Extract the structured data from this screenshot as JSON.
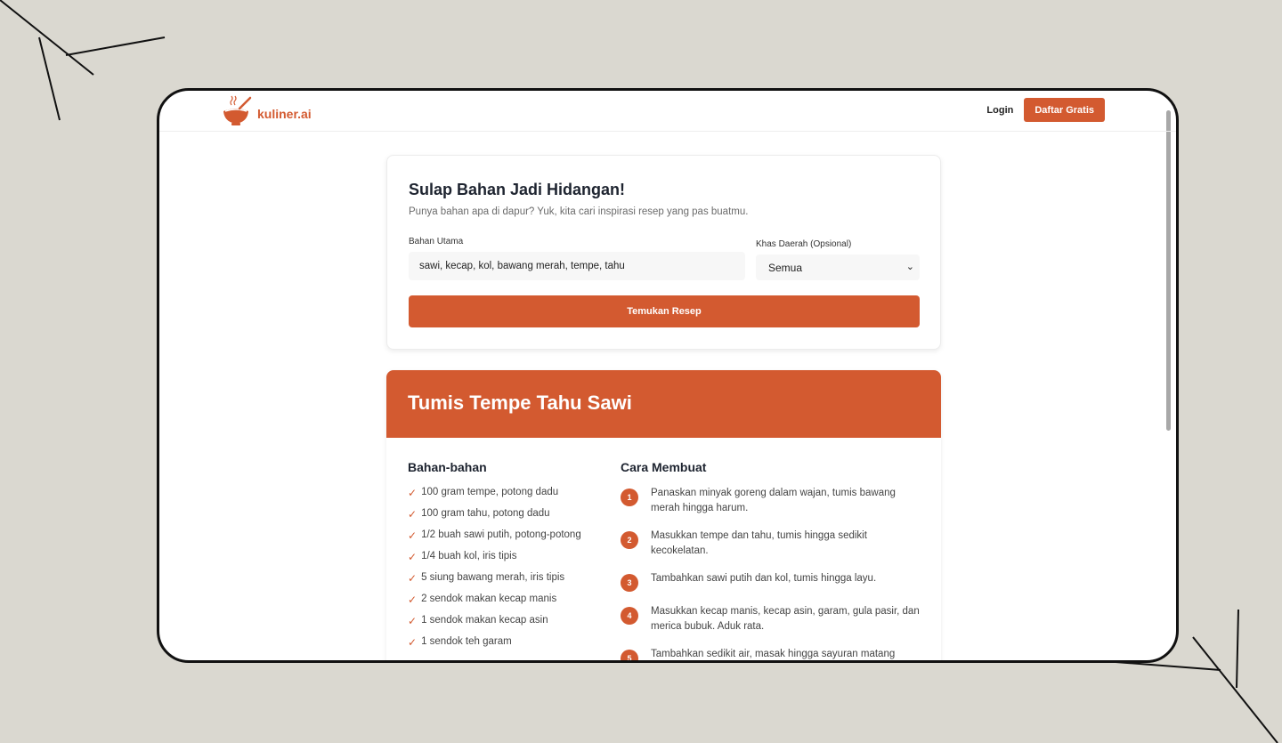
{
  "nav": {
    "brand": "kuliner.ai",
    "login": "Login",
    "signup": "Daftar Gratis"
  },
  "search": {
    "title": "Sulap Bahan Jadi Hidangan!",
    "subtitle": "Punya bahan apa di dapur? Yuk, kita cari inspirasi resep yang pas buatmu.",
    "ingredients_label": "Bahan Utama",
    "ingredients_value": "sawi, kecap, kol, bawang merah, tempe, tahu",
    "region_label": "Khas Daerah (Opsional)",
    "region_value": "Semua",
    "submit": "Temukan Resep"
  },
  "recipe": {
    "title": "Tumis Tempe Tahu Sawi",
    "ingredients_heading": "Bahan-bahan",
    "steps_heading": "Cara Membuat",
    "ingredients": [
      "100 gram tempe, potong dadu",
      "100 gram tahu, potong dadu",
      "1/2 buah sawi putih, potong-potong",
      "1/4 buah kol, iris tipis",
      "5 siung bawang merah, iris tipis",
      "2 sendok makan kecap manis",
      "1 sendok makan kecap asin",
      "1 sendok teh garam"
    ],
    "steps": [
      {
        "n": "1",
        "text": "Panaskan minyak goreng dalam wajan, tumis bawang merah hingga harum."
      },
      {
        "n": "2",
        "text": "Masukkan tempe dan tahu, tumis hingga sedikit kecokelatan."
      },
      {
        "n": "3",
        "text": "Tambahkan sawi putih dan kol, tumis hingga layu."
      },
      {
        "n": "4",
        "text": "Masukkan kecap manis, kecap asin, garam, gula pasir, dan merica bubuk. Aduk rata."
      },
      {
        "n": "5",
        "text": "Tambahkan sedikit air, masak hingga sayuran matang"
      }
    ]
  },
  "colors": {
    "accent": "#d35a30",
    "background": "#dad8d0"
  }
}
